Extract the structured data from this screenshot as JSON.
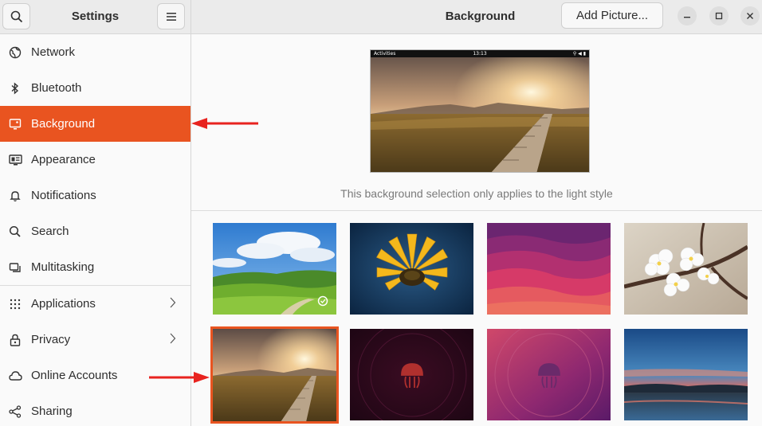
{
  "sidebar": {
    "title": "Settings",
    "items": [
      {
        "label": "Network",
        "icon": "network-icon"
      },
      {
        "label": "Bluetooth",
        "icon": "bluetooth-icon"
      },
      {
        "label": "Background",
        "icon": "background-icon",
        "active": true
      },
      {
        "label": "Appearance",
        "icon": "appearance-icon"
      },
      {
        "label": "Notifications",
        "icon": "bell-icon"
      },
      {
        "label": "Search",
        "icon": "search-icon"
      },
      {
        "label": "Multitasking",
        "icon": "multitasking-icon"
      },
      {
        "label": "Applications",
        "icon": "apps-grid-icon",
        "chevron": true
      },
      {
        "label": "Privacy",
        "icon": "lock-icon",
        "chevron": true
      },
      {
        "label": "Online Accounts",
        "icon": "cloud-icon"
      },
      {
        "label": "Sharing",
        "icon": "share-icon"
      }
    ]
  },
  "header": {
    "title": "Background",
    "add_picture_label": "Add Picture..."
  },
  "preview": {
    "topbar_activities": "Activities",
    "topbar_clock": "13:13",
    "topbar_status": "⚲ ◀ ▮",
    "caption": "This background selection only applies to the light style"
  },
  "wallpapers": [
    {
      "name": "green-hills",
      "selected": false
    },
    {
      "name": "yellow-flower",
      "selected": false
    },
    {
      "name": "purple-waves",
      "selected": false
    },
    {
      "name": "white-blossoms",
      "selected": false
    },
    {
      "name": "golden-field-sunset",
      "selected": true
    },
    {
      "name": "jellyfish-dark",
      "selected": false
    },
    {
      "name": "jellyfish-purple",
      "selected": false
    },
    {
      "name": "lake-sunset",
      "selected": false
    }
  ],
  "colors": {
    "accent": "#e95420",
    "annotation_arrow": "#e8231f"
  }
}
